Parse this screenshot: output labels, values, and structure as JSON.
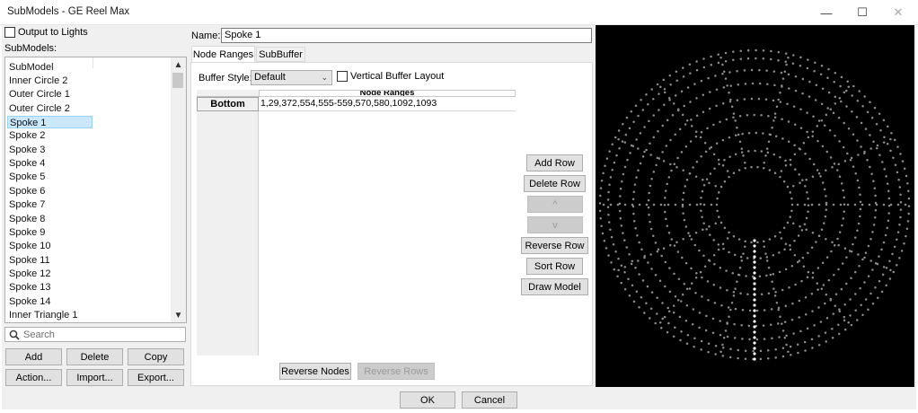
{
  "window": {
    "title": "SubModels - GE Reel Max"
  },
  "left": {
    "output_to_lights": "Output to Lights",
    "submodels_label": "SubModels:",
    "list_header": "SubModel",
    "items": [
      "Inner Circle 2",
      "Outer Circle 1",
      "Outer Circle 2",
      "Spoke 1",
      "Spoke 2",
      "Spoke 3",
      "Spoke 4",
      "Spoke 5",
      "Spoke 6",
      "Spoke 7",
      "Spoke 8",
      "Spoke 9",
      "Spoke 10",
      "Spoke 11",
      "Spoke 12",
      "Spoke 13",
      "Spoke 14",
      "Inner Triangle 1"
    ],
    "selected_item": "Spoke 1",
    "search_placeholder": "Search",
    "buttons": {
      "add": "Add",
      "delete": "Delete",
      "copy": "Copy",
      "action": "Action...",
      "import": "Import...",
      "export": "Export..."
    }
  },
  "editor": {
    "name_label": "Name:",
    "name_value": "Spoke 1",
    "tabs": [
      "Node Ranges",
      "SubBuffer"
    ],
    "active_tab": "Node Ranges",
    "buffer_style_label": "Buffer Style:",
    "buffer_style_value": "Default",
    "vertical_buffer_label": "Vertical Buffer Layout",
    "grid": {
      "column_header": "Node Ranges",
      "rows": [
        {
          "label": "Bottom",
          "value": "1,29,372,554,555-559,570,580,1092,1093"
        }
      ]
    },
    "buttons": {
      "add_row": "Add Row",
      "delete_row": "Delete Row",
      "up": "^",
      "down": "v",
      "reverse_row": "Reverse Row",
      "sort_row": "Sort Row",
      "draw_model": "Draw Model",
      "reverse_nodes": "Reverse Nodes",
      "reverse_rows": "Reverse Rows"
    }
  },
  "footer": {
    "ok": "OK",
    "cancel": "Cancel"
  },
  "colors": {
    "preview_bg": "#000000",
    "node_dim": "#8c8c8c",
    "node_highlight": "#ffffff",
    "selection": "#cce8ff"
  }
}
